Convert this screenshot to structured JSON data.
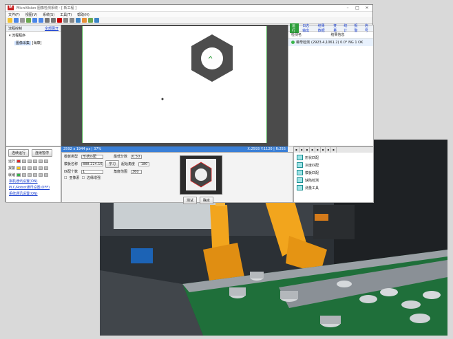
{
  "window": {
    "logo": "M",
    "title": "MicroVision  图像检测系统  -  [ 新工程 ]",
    "menus": [
      "文件(F)",
      "视图(V)",
      "系统(S)",
      "工具(T)",
      "帮助(H)"
    ]
  },
  "tree": {
    "header": "流程控制",
    "header_link": "全部展开",
    "root": "流程程序",
    "child": "图像采集",
    "child_value": "[海康]"
  },
  "canvas": {
    "status_left": "2592 x 1944 px | 37%",
    "status_right": "X:2593  Y:1120 | R:255"
  },
  "right_panel": {
    "tabs": [
      "运行",
      "日志输出",
      "结果数据",
      "变量",
      "统计",
      "报警",
      "信号"
    ],
    "col1": "检测名",
    "col2": "结果信息",
    "row_name": "螺母检测",
    "row_value": "(2923.4,1061.2) 0.0°  NG 1 OK"
  },
  "bottom_left": {
    "btn_run": "连续运行",
    "btn_stop": "连续暂停",
    "io": [
      {
        "label": "运行",
        "colors": [
          "red",
          "gray",
          "gray",
          "gray",
          "gray",
          "gray"
        ]
      },
      {
        "label": "报警",
        "colors": [
          "yel",
          "gray",
          "gray",
          "gray",
          "gray",
          "gray"
        ]
      },
      {
        "label": "就绪",
        "colors": [
          "grn",
          "gray",
          "gray",
          "gray",
          "gray",
          "gray"
        ]
      }
    ],
    "links": [
      "相机通讯设置(ON)",
      "PLC/Robot通讯设置(OFF)",
      "系统通讯设置(ON)"
    ]
  },
  "params": {
    "mode_label": "模板类型",
    "mode_value": "形状匹配",
    "match_label": "模板名称",
    "match_value": "888.224.16",
    "learn_btn": "学习",
    "score_label": "最低分数",
    "score_value": "0.50",
    "angle_label": "起始角度",
    "angle_value": "-180",
    "range_label": "角度范围",
    "range_value": "360",
    "count_label": "匹配个数",
    "count_value": "1",
    "check1": "亚像素",
    "check2": "边缘增强",
    "btn_test": "测试",
    "btn_ok": "确定"
  },
  "tools": {
    "items": [
      "形状匹配",
      "灰度匹配",
      "模板匹配",
      "缺陷检测",
      "测量工具"
    ]
  }
}
